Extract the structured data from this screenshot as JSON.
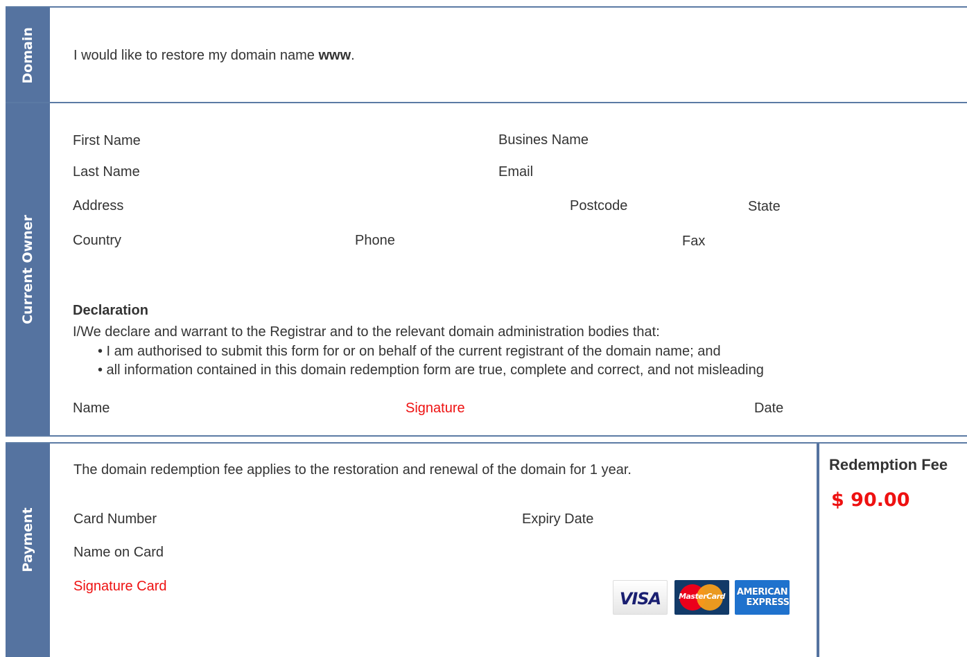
{
  "domain": {
    "side_label": "Domain",
    "text_prefix": "I would like to restore my domain name ",
    "text_bold": "www",
    "text_suffix": "."
  },
  "owner": {
    "side_label": "Current Owner",
    "fields": {
      "first_name": "First Name",
      "business_name": "Busines Name",
      "last_name": "Last Name",
      "email": "Email",
      "address": "Address",
      "postcode": "Postcode",
      "state": "State",
      "country": "Country",
      "phone": "Phone",
      "fax": "Fax"
    },
    "declaration": {
      "title": "Declaration",
      "intro": "I/We declare and warrant to the Registrar and to the relevant domain administration bodies that:",
      "bullets": [
        "• I am authorised to submit this form for or on behalf of the current registrant of the domain name; and",
        "• all information contained in this domain redemption form are true, complete and correct, and not misleading"
      ],
      "name": "Name",
      "signature": "Signature",
      "date": "Date"
    }
  },
  "payment": {
    "side_label": "Payment",
    "note": "The domain redemption fee applies to the restoration and renewal of the domain for 1 year.",
    "card_number": "Card Number",
    "expiry_date": "Expiry Date",
    "name_on_card": "Name on Card",
    "signature_card": "Signature Card",
    "cards": {
      "visa": "VISA",
      "mastercard": "MasterCard",
      "amex_line1": "AMERICAN",
      "amex_line2": "EXPRESS"
    },
    "fee_title": "Redemption Fee",
    "fee_amount": "$ 90.00"
  },
  "colors": {
    "sidebar": "#5573a0",
    "border": "#5b7aa4",
    "accent_red": "#ee1111",
    "text": "#333333"
  }
}
